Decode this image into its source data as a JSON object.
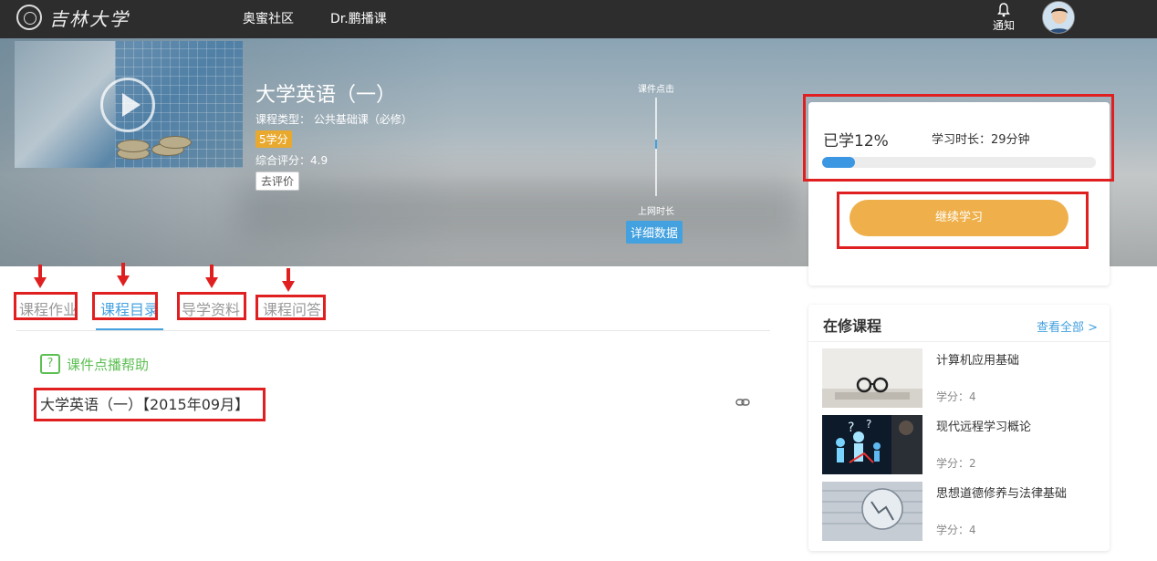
{
  "header": {
    "logo_text": "吉林大学",
    "nav": [
      "奥蜜社区",
      "Dr.鹏播课"
    ],
    "notify_label": "通知"
  },
  "course": {
    "title": "大学英语（一）",
    "type_line": "课程类型： 公共基础课（必修）",
    "credits": "5学分",
    "rating_line": "综合评分：4.9",
    "review_button": "去评价"
  },
  "stats": {
    "top_label": "课件点击",
    "bottom_label": "上网时长",
    "detail_button": "详细数据"
  },
  "progress": {
    "percent_label": "已学12%",
    "percent_value": 0.12,
    "duration_label": "学习时长：29分钟",
    "continue_button": "继续学习"
  },
  "tabs": [
    {
      "label": "课程作业",
      "active": false
    },
    {
      "label": "课程目录",
      "active": true
    },
    {
      "label": "导学资料",
      "active": false
    },
    {
      "label": "课程问答",
      "active": false
    }
  ],
  "catalog": {
    "help_text": "课件点播帮助",
    "entry": "大学英语（一）【2015年09月】"
  },
  "sidebar": {
    "title": "在修课程",
    "view_all": "查看全部 >",
    "courses": [
      {
        "name": "计算机应用基础",
        "credit": "学分：4"
      },
      {
        "name": "现代远程学习概论",
        "credit": "学分：2"
      },
      {
        "name": "思想道德修养与法律基础",
        "credit": "学分：4"
      }
    ]
  },
  "colors": {
    "accent": "#43a1e0",
    "continue": "#efb04b",
    "annotation": "#e02020",
    "help": "#5cbf52"
  }
}
